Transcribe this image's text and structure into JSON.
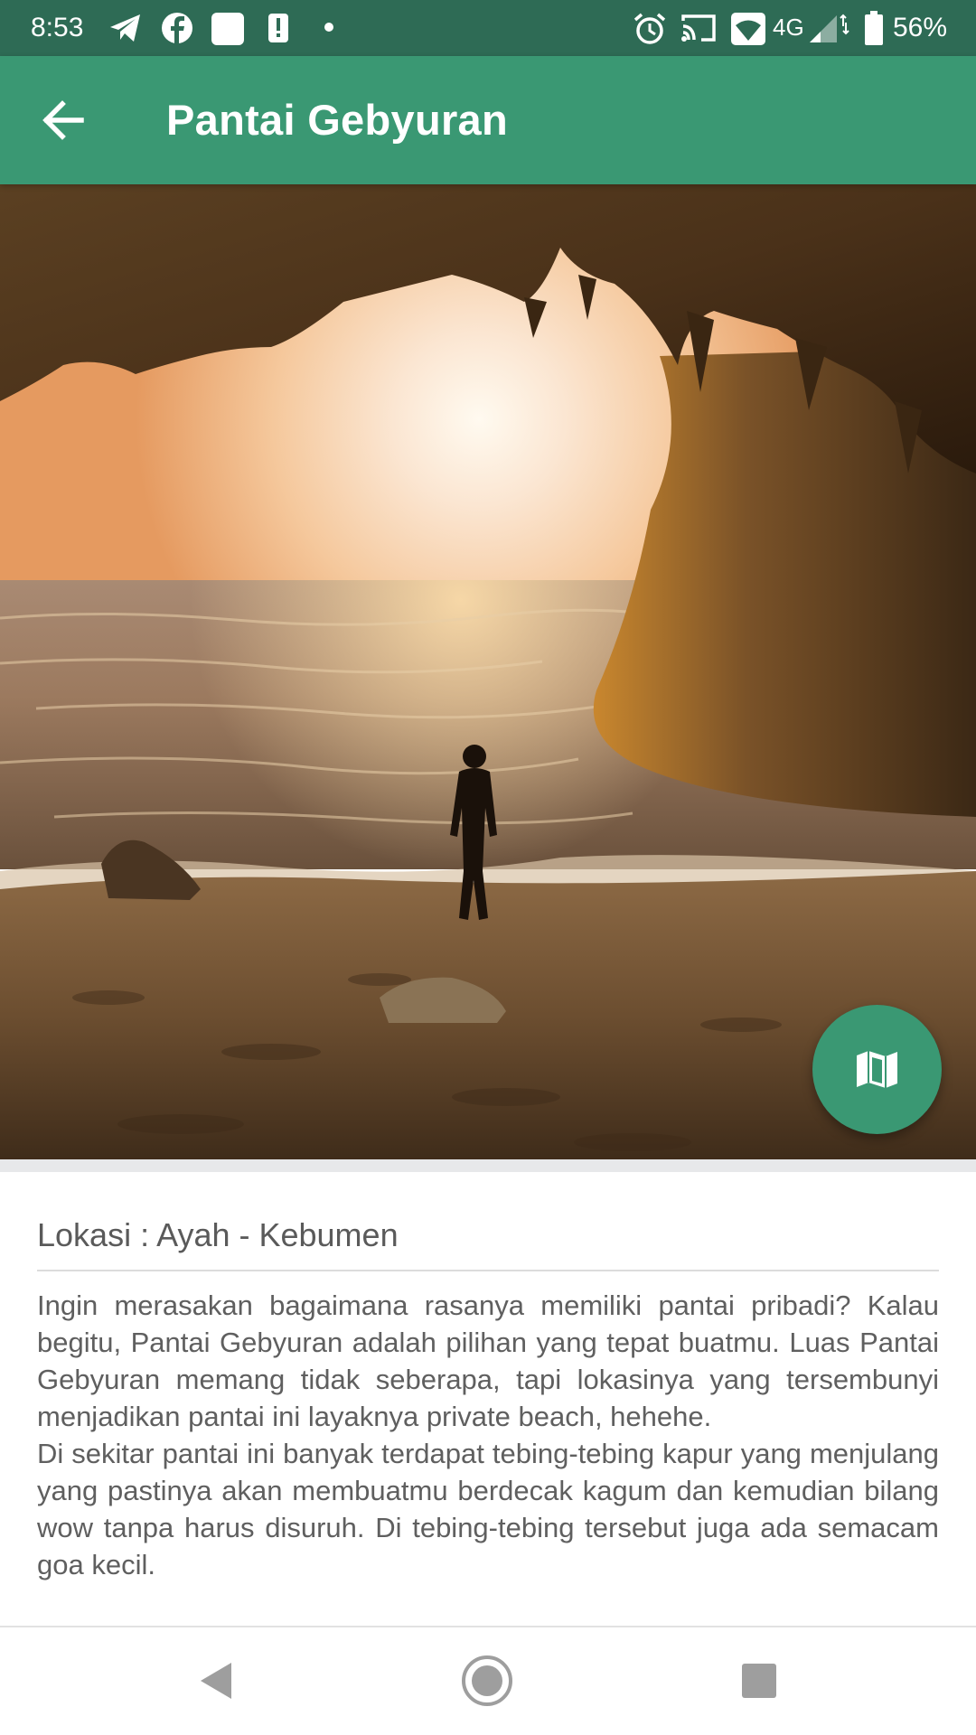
{
  "status_bar": {
    "time": "8:53",
    "network": "4G",
    "battery": "56%",
    "icons": [
      "telegram-icon",
      "facebook-icon",
      "notification-square-icon",
      "alert-icon",
      "dot-icon",
      "alarm-icon",
      "cast-icon",
      "wifi-icon",
      "signal-icon",
      "battery-icon"
    ]
  },
  "app_bar": {
    "title": "Pantai Gebyuran",
    "back_icon": "arrow-back-icon",
    "color": "#3a9873"
  },
  "hero": {
    "image": "beach-cave-sunset-photo"
  },
  "fab": {
    "icon": "map-icon",
    "color": "#3a9873"
  },
  "content": {
    "location": "Lokasi : Ayah - Kebumen",
    "description": "Ingin merasakan bagaimana rasanya memiliki pantai pribadi? Kalau begitu, Pantai Gebyuran adalah pilihan yang tepat buatmu. Luas Pantai Gebyuran memang tidak seberapa, tapi lokasinya yang tersembunyi menjadikan pantai ini layaknya private beach, hehehe.\nDi sekitar pantai ini banyak terdapat tebing-tebing kapur yang menjulang yang pastinya akan membuatmu berdecak kagum dan kemudian bilang wow tanpa harus disuruh. Di tebing-tebing tersebut juga ada semacam goa kecil."
  },
  "nav_bar": {
    "buttons": [
      "back-triangle-icon",
      "home-circle-icon",
      "recents-square-icon"
    ]
  }
}
